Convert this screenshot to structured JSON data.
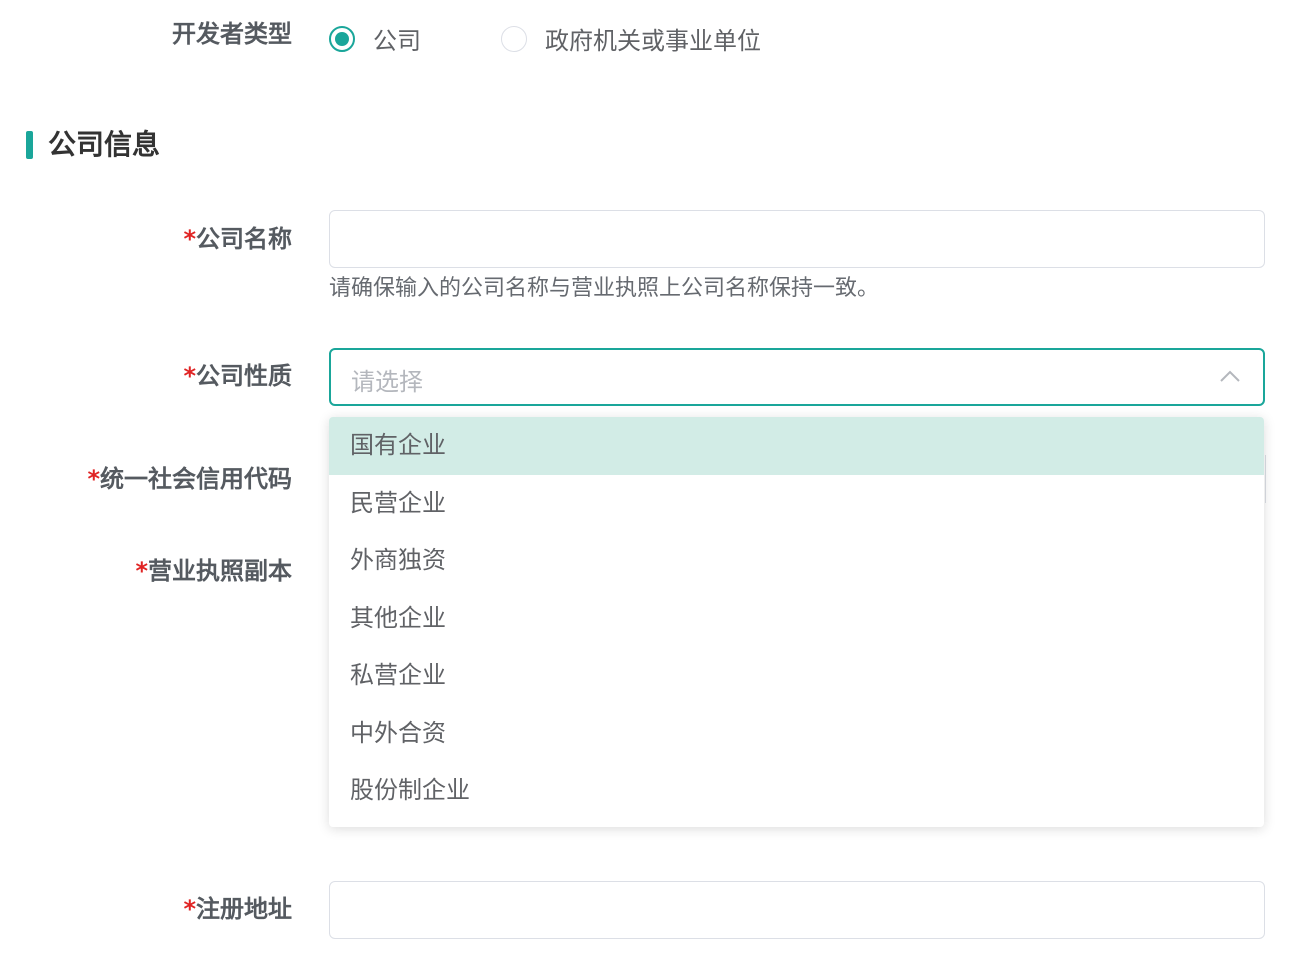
{
  "developer_type": {
    "label": "开发者类型",
    "options": [
      {
        "label": "公司",
        "checked": true
      },
      {
        "label": "政府机关或事业单位",
        "checked": false
      }
    ]
  },
  "section": {
    "title": "公司信息"
  },
  "fields": {
    "required_mark": "*",
    "company_name": {
      "label": "公司名称",
      "value": "",
      "hint": "请确保输入的公司名称与营业执照上公司名称保持一致。"
    },
    "company_nature": {
      "label": "公司性质",
      "placeholder": "请选择",
      "options": [
        "国有企业",
        "民营企业",
        "外商独资",
        "其他企业",
        "私营企业",
        "中外合资",
        "股份制企业"
      ],
      "highlighted_index": 0
    },
    "credit_code": {
      "label": "统一社会信用代码"
    },
    "license_copy": {
      "label": "营业执照副本"
    },
    "address": {
      "label": "注册地址",
      "value": ""
    }
  },
  "colors": {
    "accent": "#1aa69a",
    "required": "#e02424",
    "option_highlight": "#d2ece6"
  }
}
